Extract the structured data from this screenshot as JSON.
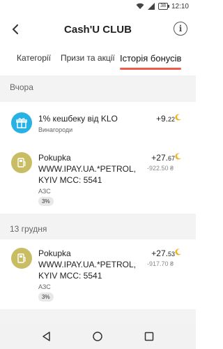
{
  "status_bar": {
    "battery": "38",
    "time": "12:10"
  },
  "header": {
    "title": "Cash'U CLUB",
    "info_icon": "info-icon",
    "back_icon": "back-arrow-icon"
  },
  "tabs": [
    {
      "label": "Категорії",
      "active": false
    },
    {
      "label": "Призи та акції",
      "active": false
    },
    {
      "label": "Історія бонусів",
      "active": true
    }
  ],
  "accent_color": "#f05a4a",
  "groups": [
    {
      "date": "Вчора",
      "items": [
        {
          "icon": "gift-icon",
          "title": "1% кешбеку від KLO",
          "subtitle": "Винагороди",
          "bonus_int": "+9.",
          "bonus_dec": "22"
        },
        {
          "icon": "fuel-receipt-icon",
          "title": "Pokupka WWW.IPAY.UA.*PETROL, KYIV MCC: 5541",
          "subtitle": "АЗС",
          "badge": "3%",
          "bonus_int": "+27.",
          "bonus_dec": "67",
          "purchase": "-922.50 ₴"
        }
      ]
    },
    {
      "date": "13 грудня",
      "items": [
        {
          "icon": "fuel-receipt-icon",
          "title": "Pokupka WWW.IPAY.UA.*PETROL, KYIV MCC: 5541",
          "subtitle": "АЗС",
          "badge": "3%",
          "bonus_int": "+27.",
          "bonus_dec": "53",
          "purchase": "-917.70 ₴"
        }
      ]
    }
  ]
}
